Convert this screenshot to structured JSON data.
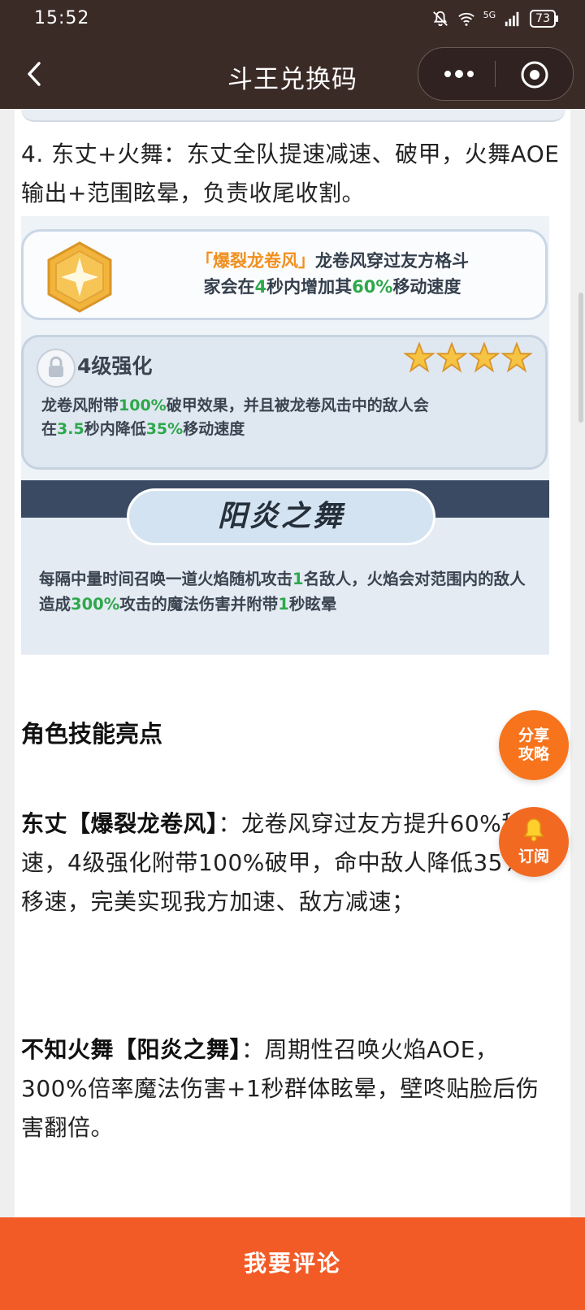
{
  "status_bar": {
    "time": "15:52",
    "network": "5G",
    "battery": "73"
  },
  "nav": {
    "title": "斗王兑换码"
  },
  "article": {
    "para1": "4. 东丈+火舞：东丈全队提速减速、破甲，火舞AOE输出+范围眩晕，负责收尾收割。",
    "image": {
      "card1": {
        "quote": "「爆裂龙卷风」",
        "t1": "龙卷风穿过友方格斗",
        "t2": "家会在",
        "n1": "4",
        "t3": "秒内增加其",
        "n2": "60%",
        "t4": "移动速度"
      },
      "card2": {
        "title": "4级强化",
        "t1": "龙卷风附带",
        "n1": "100%",
        "t2": "破甲效果，并且被龙卷风击中的敌人会",
        "t3": "在",
        "n2": "3.5",
        "t4": "秒内降低",
        "n3": "35%",
        "t5": "移动速度"
      },
      "card3": {
        "title": "阳炎之舞",
        "t1": "每隔中量时间召唤一道火焰随机攻击",
        "n1": "1",
        "t2": "名敌人，火焰会对范围内的敌人造成",
        "n2": "300%",
        "t3": "攻击的魔法伤害并附带",
        "n3": "1",
        "t4": "秒眩晕"
      }
    },
    "heading": "角色技能亮点",
    "p2_bold": "东丈【爆裂龙卷风】",
    "p2_text": "：龙卷风穿过友方提升60%移速，4级强化附带100%破甲，命中敌人降低35%移速，完美实现我方加速、敌方减速；",
    "p3_bold": "不知火舞【阳炎之舞】",
    "p3_text": "：周期性召唤火焰AOE，300%倍率魔法伤害+1秒群体眩晕，壁咚贴脸后伤害翻倍。"
  },
  "fab": {
    "share": "分享攻略",
    "share_l1": "分享",
    "share_l2": "攻略",
    "subscribe": "订阅"
  },
  "bottom": {
    "comment": "我要评论"
  },
  "colors": {
    "header_bg": "#3b2b27",
    "accent": "#f35b26",
    "highlight_green": "#2ea84a",
    "highlight_orange": "#f09020"
  }
}
